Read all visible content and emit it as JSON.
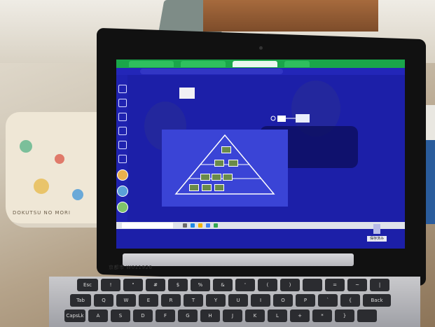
{
  "browser": {
    "tabs": [
      "",
      "",
      "",
      ""
    ],
    "url": ""
  },
  "app": {
    "top_right_line1": "",
    "top_right_line2": "",
    "top_right_line3": "",
    "save_button": "保存済み"
  },
  "sidebar": {
    "avatars": [
      "",
      "",
      ""
    ]
  },
  "taskbar": {
    "search_placeholder": ""
  },
  "label_on_laptop": "京都市 W011926",
  "pencil_case_text": "DOKUTSU NO MORI",
  "keyboard": {
    "row1": [
      "Esc",
      "!",
      "\"",
      "#",
      "$",
      "%",
      "&",
      "'",
      "(",
      ")",
      "",
      "=",
      "~",
      "|"
    ],
    "row2": [
      "Tab",
      "Q",
      "W",
      "E",
      "R",
      "T",
      "Y",
      "U",
      "I",
      "O",
      "P",
      "`",
      "{",
      "Back"
    ],
    "row3": [
      "CapsLk",
      "A",
      "S",
      "D",
      "F",
      "G",
      "H",
      "J",
      "K",
      "L",
      "+",
      "*",
      "}",
      ""
    ]
  },
  "colors": {
    "screen_bg": "#1c1fa8",
    "browser_chrome": "#1aa64a",
    "bezel": "#111111"
  }
}
